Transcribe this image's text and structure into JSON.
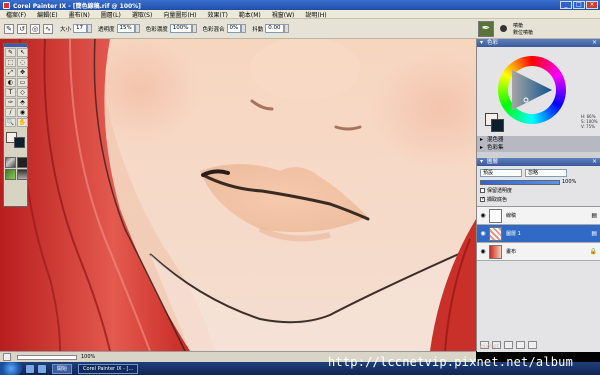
{
  "window": {
    "title": "Corel Painter IX - [簡色線稿.rif @ 100%]",
    "buttons": [
      "_",
      "□",
      "×"
    ]
  },
  "menu": [
    "檔案(F)",
    "編輯(E)",
    "畫布(N)",
    "圖層(L)",
    "選取(S)",
    "向量圖形(H)",
    "效果(T)",
    "範本(M)",
    "視窗(W)",
    "說明(H)"
  ],
  "propbar": {
    "size_label": "大小",
    "size_value": "17",
    "opacity_label": "透明度",
    "opacity_value": "15%",
    "grain_label": "色彩濃度",
    "grain_value": "100%",
    "resat_label": "色彩混合",
    "resat_value": "0%",
    "jitter_label": "抖動",
    "jitter_value": "0.00"
  },
  "brush": {
    "category": "噴槍",
    "variant": "數位噴槍"
  },
  "toolbox": {
    "tools": [
      "✎",
      "↖",
      "⬚",
      "◌",
      "⤢",
      "✥",
      "◐",
      "▭",
      "T",
      "◇",
      "✑",
      "⬘",
      "∕",
      "◉",
      "🔍",
      "✋"
    ]
  },
  "palettes": {
    "color_title": "色彩",
    "color_values": [
      "H: 66%",
      "S: 100%",
      "V: 75%"
    ],
    "mixer_title": "混色器",
    "colorset_title": "色彩集",
    "layers_title": "圖層"
  },
  "layers": {
    "composite_method": "預設",
    "composite_depth": "忽略",
    "opacity": "100%",
    "preserve_transparency": "保留透明度",
    "pick_up_color": "擷取底色",
    "items": [
      {
        "name": "線稿",
        "selected": false
      },
      {
        "name": "圖層 1",
        "selected": true
      },
      {
        "name": "畫布",
        "selected": false
      }
    ]
  },
  "status": {
    "zoom": "100%"
  },
  "taskbar": {
    "tasks": [
      "開始",
      "Corel Painter IX - [..."
    ]
  },
  "watermark": "http://lccnetvip.pixnet.net/album",
  "colors": {
    "skin": "#f3cdb5",
    "hair": "#d6352c",
    "accent": "#316ac5"
  }
}
